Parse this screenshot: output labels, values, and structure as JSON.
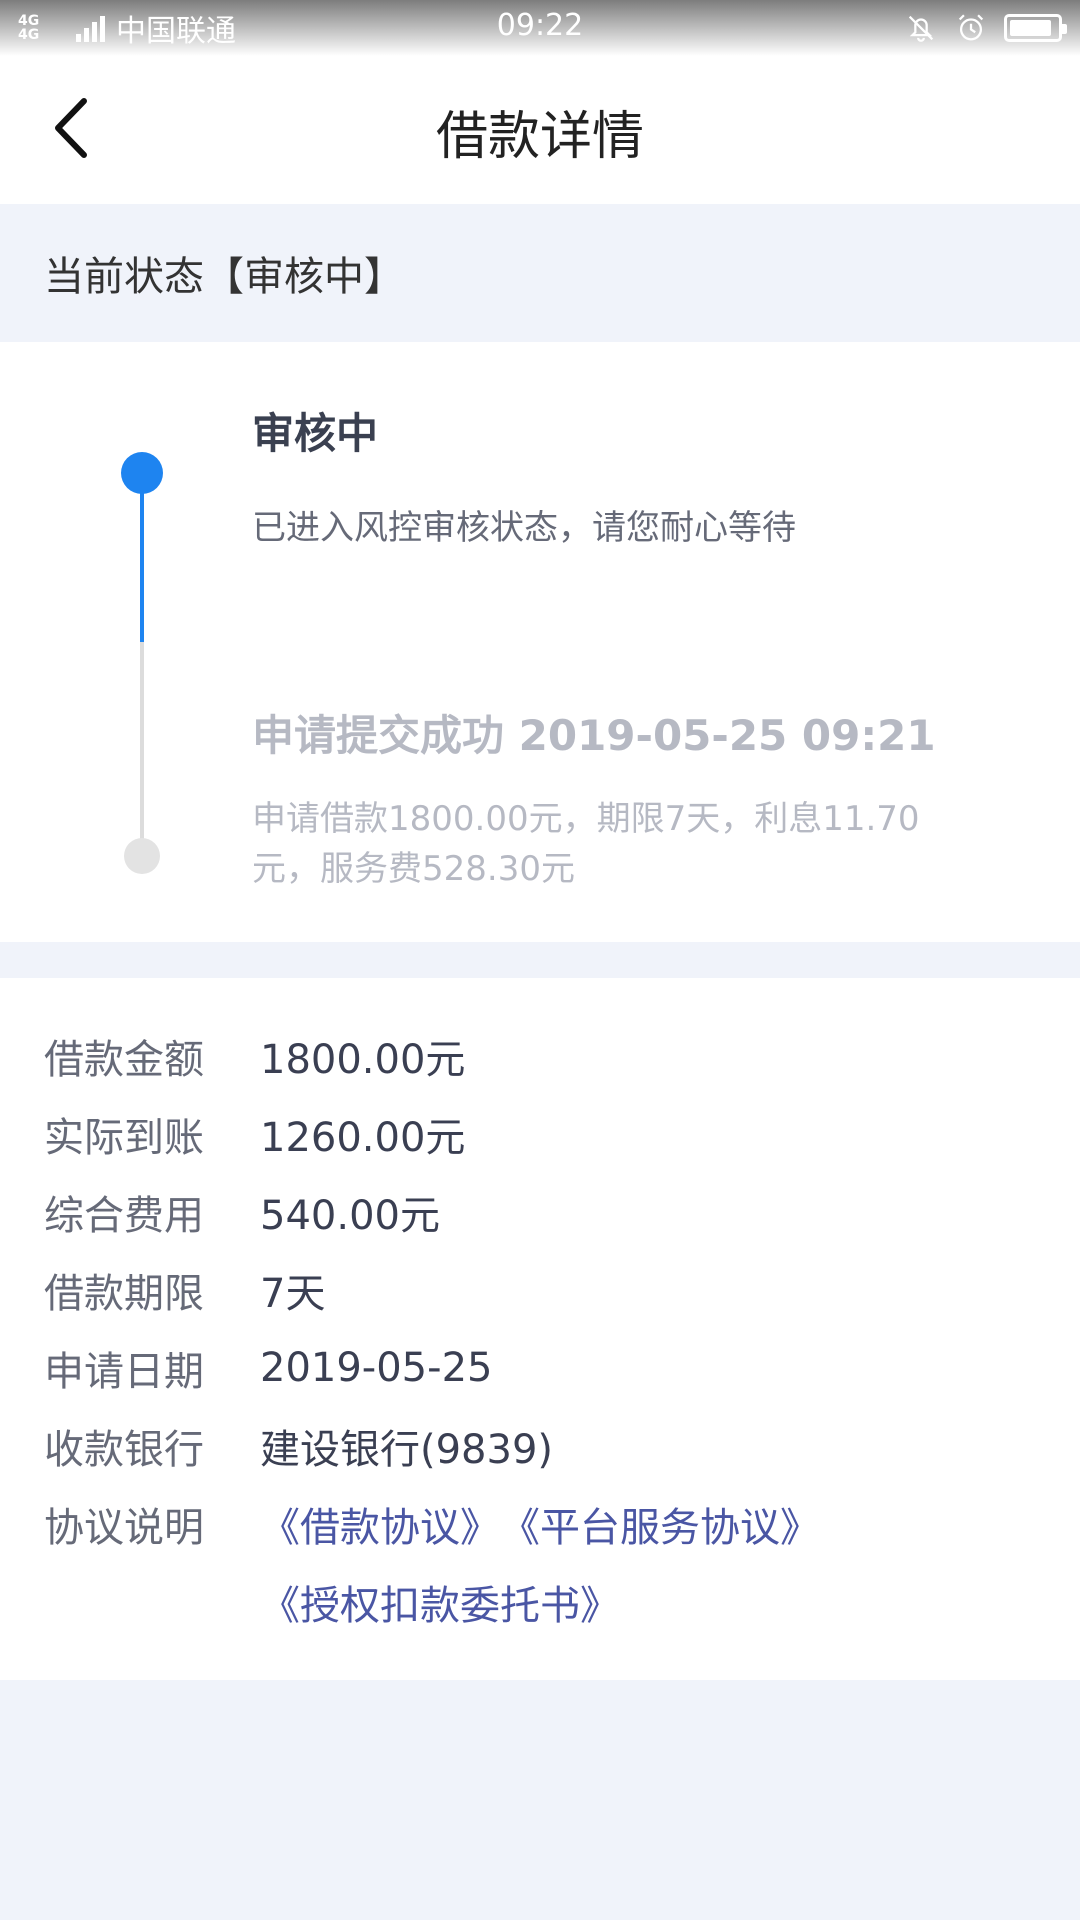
{
  "status_bar": {
    "network_top": "4G",
    "network_bottom": "4G",
    "carrier": "中国联通",
    "time": "09:22",
    "battery_level": 0.9
  },
  "header": {
    "back_icon": "chevron-left-icon",
    "title": "借款详情"
  },
  "status_strip": {
    "text": "当前状态【审核中】"
  },
  "timeline": {
    "active_color": "#1e84f0",
    "steps": [
      {
        "title": "审核中",
        "desc": "已进入风控审核状态，请您耐心等待",
        "active": true
      },
      {
        "title": "申请提交成功 2019-05-25 09:21",
        "desc": "申请借款1800.00元，期限7天，利息11.70元，服务费528.30元",
        "active": false
      }
    ]
  },
  "details": {
    "rows": [
      {
        "label": "借款金额",
        "value": "1800.00元"
      },
      {
        "label": "实际到账",
        "value": "1260.00元"
      },
      {
        "label": "综合费用",
        "value": "540.00元"
      },
      {
        "label": "借款期限",
        "value": "7天"
      },
      {
        "label": "申请日期",
        "value": "2019-05-25"
      },
      {
        "label": "收款银行",
        "value": "建设银行(9839)"
      }
    ],
    "agreement_label": "协议说明",
    "agreements": [
      "《借款协议》",
      "《平台服务协议》",
      "《授权扣款委托书》"
    ],
    "link_color": "#4a56a4"
  }
}
